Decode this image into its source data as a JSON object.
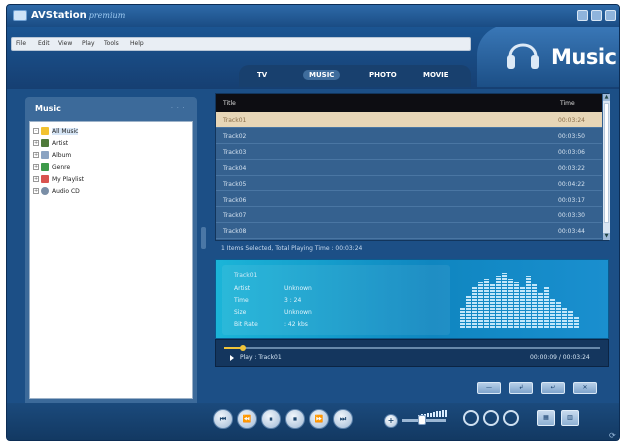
{
  "window": {
    "app_title": "AVStation",
    "app_edition": "premium",
    "controls": [
      "minimize-icon",
      "restore-icon",
      "close-icon"
    ]
  },
  "menu": [
    "File",
    "Edit",
    "View",
    "Play",
    "Tools",
    "Help"
  ],
  "section_title": "Music",
  "tabs": [
    {
      "label": "TV",
      "active": false
    },
    {
      "label": "MUSIC",
      "active": true
    },
    {
      "label": "PHOTO",
      "active": false
    },
    {
      "label": "MOVIE",
      "active": false
    }
  ],
  "sidebar": {
    "title": "Music",
    "items": [
      {
        "label": "All Music",
        "icon": "music-note-icon",
        "color": "#f2c230",
        "selected": true
      },
      {
        "label": "Artist",
        "icon": "person-icon",
        "color": "#4f7a3a",
        "selected": false
      },
      {
        "label": "Album",
        "icon": "album-icon",
        "color": "#8aa3c2",
        "selected": false
      },
      {
        "label": "Genre",
        "icon": "genre-icon",
        "color": "#3d9a4a",
        "selected": false
      },
      {
        "label": "My Playlist",
        "icon": "playlist-icon",
        "color": "#d9534f",
        "selected": false
      },
      {
        "label": "Audio CD",
        "icon": "cd-icon",
        "color": "#7a8ea6",
        "selected": false
      }
    ],
    "action_label": "⎘ +"
  },
  "tracklist": {
    "columns": {
      "title": "Title",
      "time": "Time"
    },
    "rows": [
      {
        "title": "Track01",
        "time": "00:03:24",
        "selected": true
      },
      {
        "title": "Track02",
        "time": "00:03:50",
        "selected": false
      },
      {
        "title": "Track03",
        "time": "00:03:06",
        "selected": false
      },
      {
        "title": "Track04",
        "time": "00:03:22",
        "selected": false
      },
      {
        "title": "Track05",
        "time": "00:04:22",
        "selected": false
      },
      {
        "title": "Track06",
        "time": "00:03:17",
        "selected": false
      },
      {
        "title": "Track07",
        "time": "00:03:30",
        "selected": false
      },
      {
        "title": "Track08",
        "time": "00:03:44",
        "selected": false
      }
    ]
  },
  "status_text": "1 Items Selected, Total Playing Time : 00:03:24",
  "info": {
    "track": "Track01",
    "fields": [
      {
        "key": "Artist",
        "value": "Unknown"
      },
      {
        "key": "Time",
        "value": "3 : 24"
      },
      {
        "key": "Size",
        "value": "Unknown"
      },
      {
        "key": "Bit Rate",
        "value": ": 42 kbs"
      }
    ],
    "eq_levels": [
      0.35,
      0.55,
      0.7,
      0.8,
      0.85,
      0.75,
      0.9,
      0.95,
      0.85,
      0.8,
      0.7,
      0.9,
      0.75,
      0.6,
      0.7,
      0.5,
      0.45,
      0.35,
      0.3,
      0.2
    ]
  },
  "playback": {
    "now_playing": "Play : Track01",
    "time_readout": "00:00:09 / 00:03:24",
    "progress_fraction": 0.05
  },
  "panel_buttons": [
    "—",
    "↲",
    "↵",
    "✕"
  ],
  "transport": [
    {
      "name": "skip-back-button",
      "glyph": "⏮"
    },
    {
      "name": "rewind-button",
      "glyph": "⏪"
    },
    {
      "name": "pause-button",
      "glyph": "⏸"
    },
    {
      "name": "stop-button",
      "glyph": "⏹"
    },
    {
      "name": "fast-forward-button",
      "glyph": "⏩"
    },
    {
      "name": "skip-forward-button",
      "glyph": "⏭"
    }
  ],
  "volume": {
    "level_fraction": 0.45
  },
  "view_buttons": [
    "▦",
    "▥"
  ],
  "colors": {
    "accent": "#1c4f86",
    "selection": "#e7d6b7",
    "progress": "#f0c43a"
  }
}
